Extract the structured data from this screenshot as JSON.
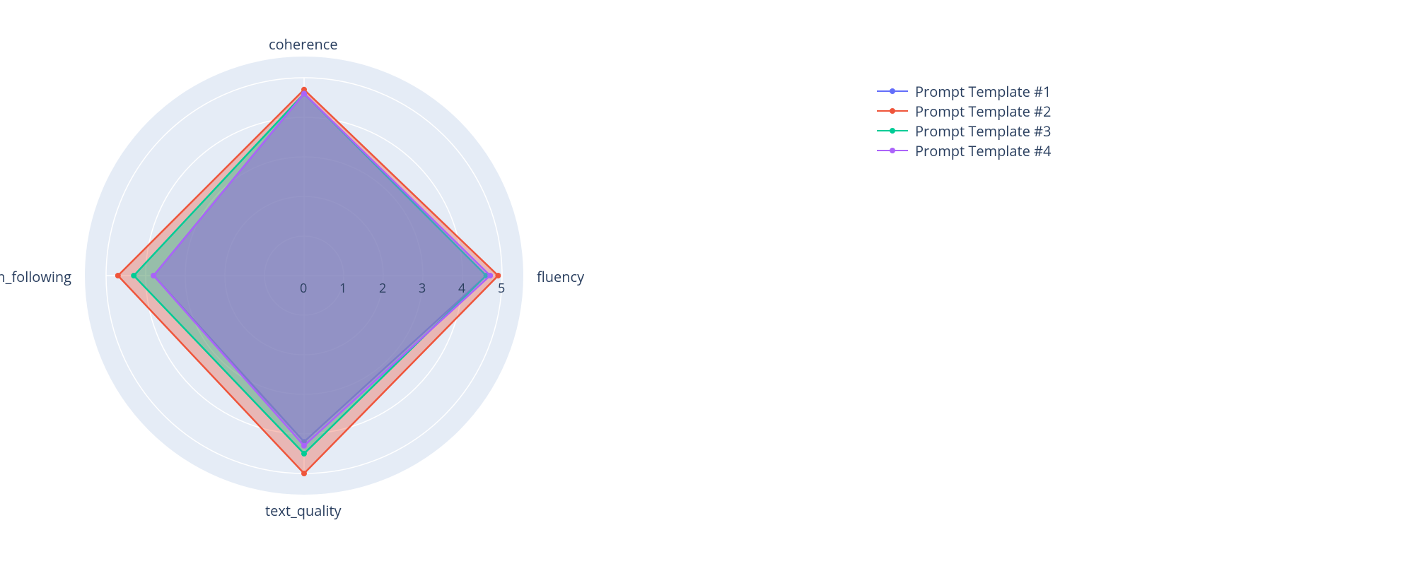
{
  "chart_data": {
    "type": "radar",
    "range": [
      0,
      5
    ],
    "ticks": [
      0,
      1,
      2,
      3,
      4,
      5
    ],
    "categories": [
      "fluency",
      "coherence",
      "instruction_following",
      "text_quality"
    ],
    "series": [
      {
        "name": "Prompt Template #1",
        "color": "#636efa",
        "values": [
          4.6,
          4.6,
          3.8,
          4.2
        ]
      },
      {
        "name": "Prompt Template #2",
        "color": "#ef553b",
        "values": [
          4.9,
          4.7,
          4.7,
          5.0
        ]
      },
      {
        "name": "Prompt Template #3",
        "color": "#00cc96",
        "values": [
          4.6,
          4.6,
          4.3,
          4.5
        ]
      },
      {
        "name": "Prompt Template #4",
        "color": "#ab63fa",
        "values": [
          4.7,
          4.6,
          3.8,
          4.3
        ]
      }
    ]
  },
  "axis_labels": {
    "fluency": "fluency",
    "coherence": "coherence",
    "instruction_following": "instruction_following",
    "text_quality": "text_quality"
  },
  "tick_labels": [
    "0",
    "1",
    "2",
    "3",
    "4",
    "5"
  ],
  "legend": {
    "items": [
      "Prompt Template #1",
      "Prompt Template #2",
      "Prompt Template #3",
      "Prompt Template #4"
    ]
  }
}
